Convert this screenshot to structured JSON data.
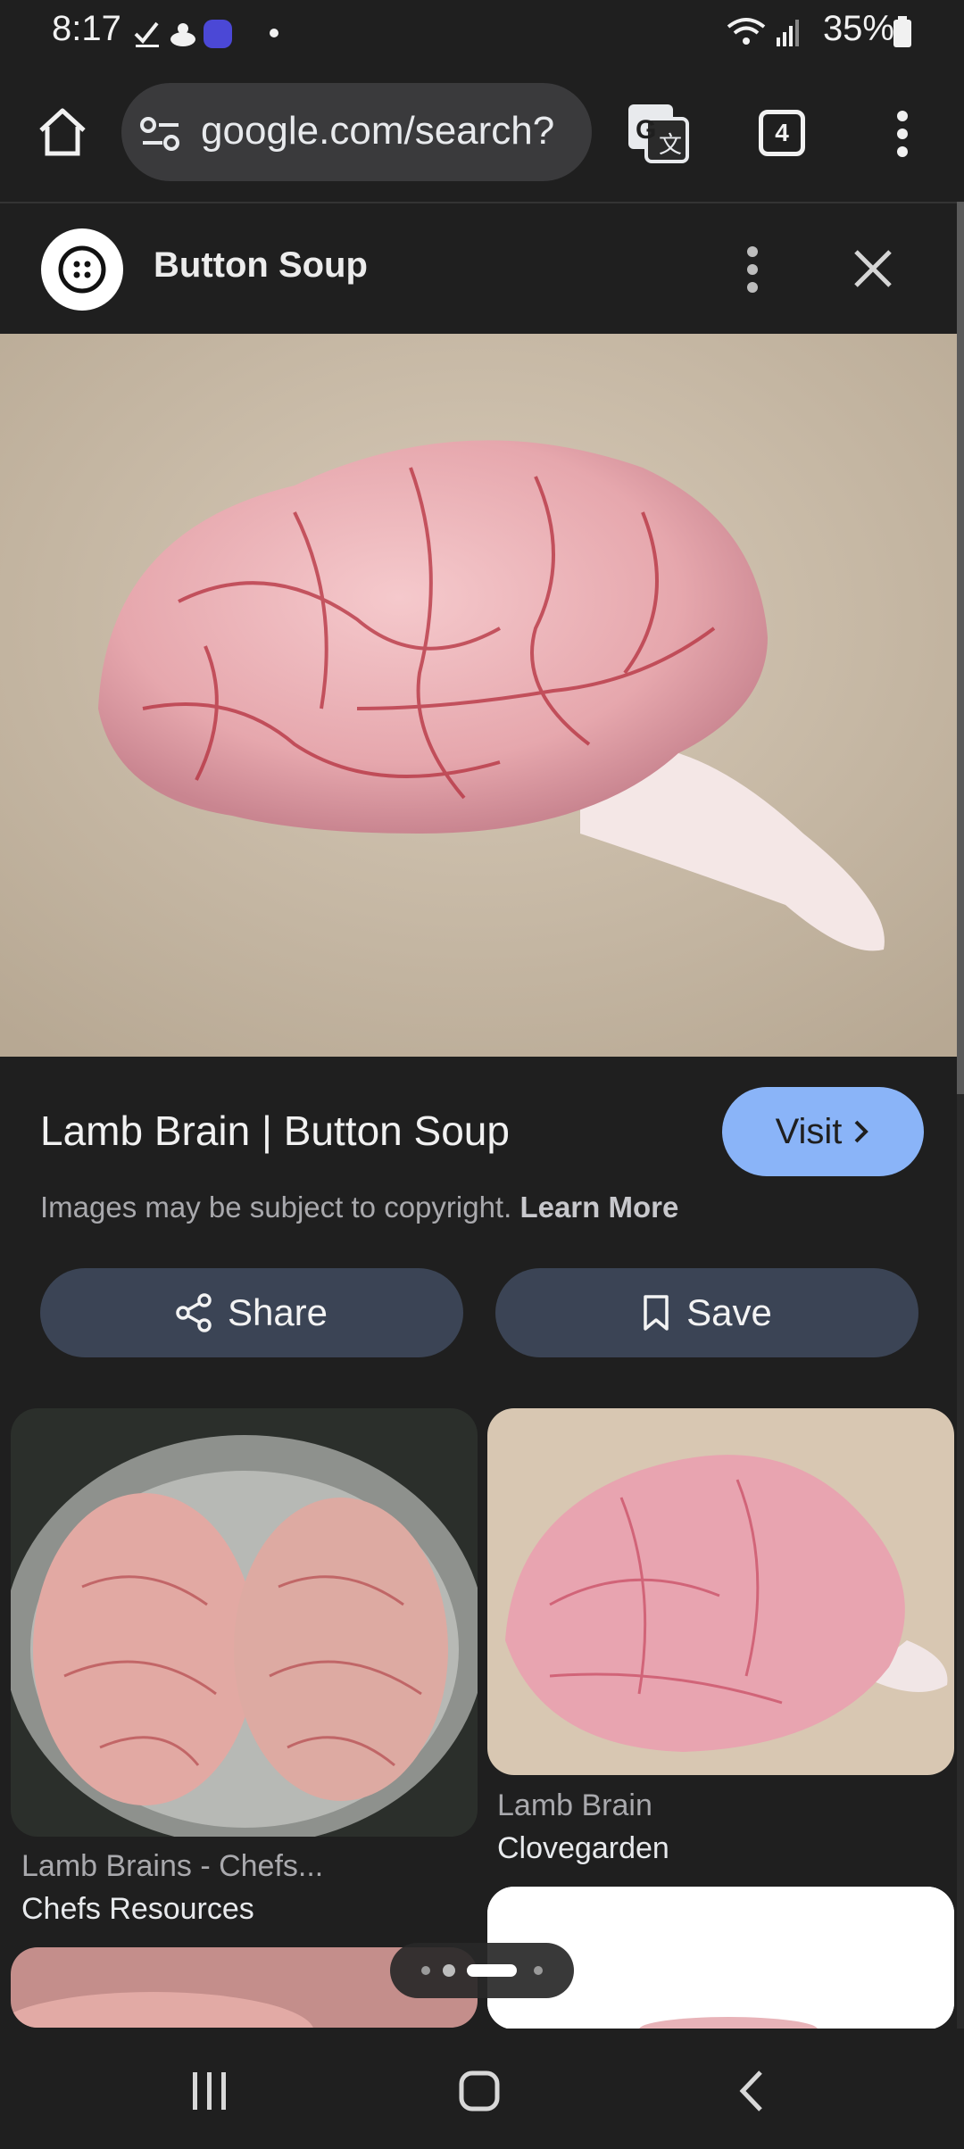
{
  "status_bar": {
    "time": "8:17",
    "battery": "35%",
    "icons": [
      "check-icon",
      "weather-icon",
      "app-notification-icon",
      "dot-icon",
      "wifi-icon",
      "signal-icon",
      "battery-icon"
    ]
  },
  "browser": {
    "address": "google.com/search?",
    "tab_count": "4",
    "icons": [
      "home-icon",
      "site-settings-icon",
      "translate-icon",
      "tabs-icon",
      "more-vert-icon"
    ]
  },
  "panel": {
    "site_name": "Button Soup",
    "icons": [
      "site-logo-icon",
      "more-vert-icon",
      "close-icon"
    ]
  },
  "result": {
    "title": "Lamb Brain | Button Soup",
    "visit_label": "Visit",
    "copyright": "Images may be subject to copyright.",
    "learn_more": "Learn More",
    "share_label": "Share",
    "save_label": "Save"
  },
  "related": [
    {
      "title": "Lamb Brains - Chefs...",
      "source": "Chefs Resources"
    },
    {
      "title": "Lamb Brain",
      "source": "Clovegarden"
    }
  ],
  "colors": {
    "background": "#1f1f1f",
    "visit_button": "#8ab4f8",
    "action_button": "#3b4455"
  }
}
